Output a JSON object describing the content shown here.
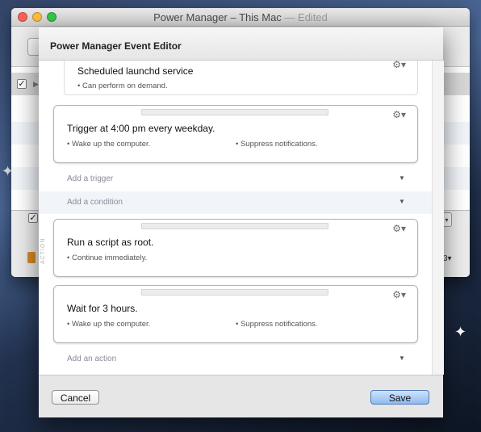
{
  "main_window": {
    "title": "Power Manager – This Mac",
    "title_suffix": "— Edited"
  },
  "sheet": {
    "title": "Power Manager Event Editor",
    "cancel_label": "Cancel",
    "save_label": "Save",
    "side_label": "ACTION"
  },
  "cards": {
    "service": {
      "title": "Scheduled launchd service",
      "note": "• Can perform on demand."
    },
    "trigger": {
      "title": "Trigger at 4:00 pm every weekday.",
      "note1": "• Wake up the computer.",
      "note2": "• Suppress notifications."
    },
    "action_script": {
      "title": "Run a script as root.",
      "note1": "• Continue immediately."
    },
    "action_wait": {
      "title": "Wait for 3 hours.",
      "note1": "• Wake up the computer.",
      "note2": "• Suppress notifications."
    }
  },
  "add_rows": {
    "trigger": "Add a trigger",
    "condition": "Add a condition",
    "action": "Add an action"
  },
  "icons": {
    "gear": "⚙▾",
    "disclosure": "▼"
  },
  "colors": {
    "save_button": "#8fbaf0",
    "condition_row_bg": "#f1f5fa"
  }
}
